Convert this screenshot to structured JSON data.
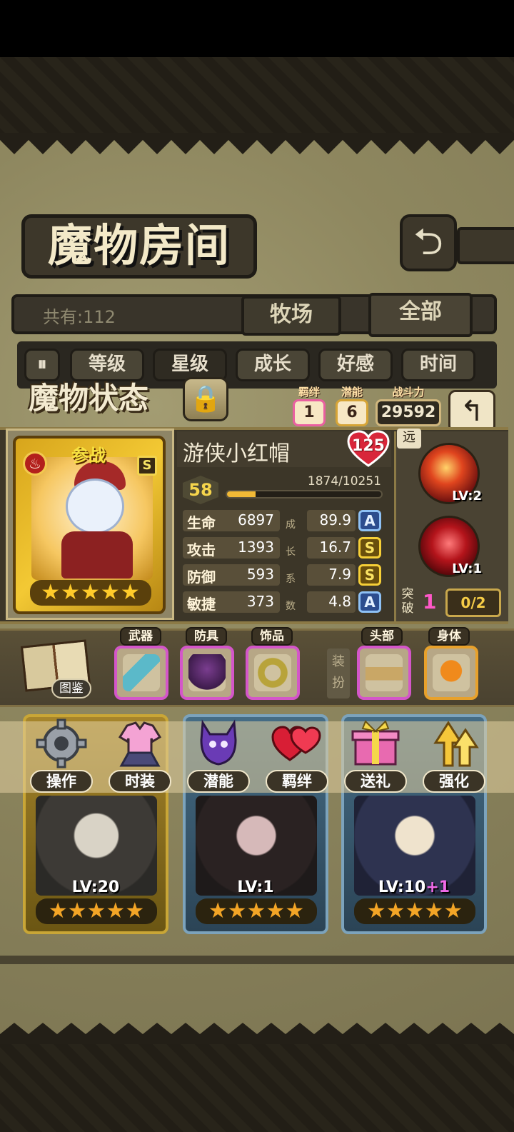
{
  "room": {
    "title": "魔物房间",
    "back_icon": "return-arrow-icon",
    "total_label": "共有:112",
    "tabs": [
      {
        "label": "牧场",
        "active": false
      },
      {
        "label": "全部",
        "active": true
      }
    ],
    "sort_buttons": [
      {
        "label": "等级",
        "active": false
      },
      {
        "label": "星级",
        "active": true
      },
      {
        "label": "成长",
        "active": false
      },
      {
        "label": "好感",
        "active": false
      },
      {
        "label": "时间",
        "active": false
      }
    ]
  },
  "status": {
    "title": "魔物状态",
    "bond_label": "羁绊",
    "bond_value": "1",
    "potential_label": "潜能",
    "potential_value": "6",
    "power_label": "战斗力",
    "power_value": "29592"
  },
  "hero": {
    "name": "游侠小红帽",
    "affection": "125",
    "standby_label": "参战",
    "rank": "S",
    "level": "58",
    "exp_text": "1874/10251",
    "exp_fraction": 0.183,
    "stars": "★★★★★",
    "stats": [
      {
        "name": "生命",
        "value": "6897",
        "growth": "89.9",
        "grade": "A"
      },
      {
        "name": "攻击",
        "value": "1393",
        "growth": "16.7",
        "grade": "S"
      },
      {
        "name": "防御",
        "value": "593",
        "growth": "7.9",
        "grade": "S"
      },
      {
        "name": "敏捷",
        "value": "373",
        "growth": "4.8",
        "grade": "A"
      }
    ],
    "growth_caption": [
      "成",
      "长",
      "系",
      "数"
    ]
  },
  "skills": {
    "range_tag": "远",
    "items": [
      {
        "level": "LV:2",
        "icon": "fire-arrow-skill-icon"
      },
      {
        "level": "LV:1",
        "icon": "blood-orb-skill-icon"
      }
    ],
    "break_label": "突破",
    "break_value": "1",
    "break_progress": "0/2"
  },
  "equipment": {
    "album_label": "图鉴",
    "slots": [
      {
        "label": "武器",
        "icon": "crossbow-icon"
      },
      {
        "label": "防具",
        "icon": "hood-cloak-icon"
      },
      {
        "label": "饰品",
        "icon": "ring-icon"
      }
    ],
    "outfit_tag": "装扮",
    "outfit_slots": [
      {
        "label": "头部",
        "icon": "crown-icon"
      },
      {
        "label": "身体",
        "icon": "pumpkin-icon"
      }
    ]
  },
  "actions": [
    {
      "label": "操作",
      "icon": "gear-icon"
    },
    {
      "label": "时装",
      "icon": "dress-icon"
    },
    {
      "label": "潜能",
      "icon": "demon-icon"
    },
    {
      "label": "羁绊",
      "icon": "hearts-icon"
    },
    {
      "label": "送礼",
      "icon": "gift-icon"
    },
    {
      "label": "强化",
      "icon": "up-arrows-icon"
    }
  ],
  "monster_cards": [
    {
      "level": "LV:20",
      "plus": "",
      "stars": "★★★★★"
    },
    {
      "level": "LV:1",
      "plus": "",
      "stars": "★★★★★"
    },
    {
      "level": "LV:10",
      "plus": "+1",
      "stars": "★★★★★"
    }
  ],
  "colors": {
    "panel_dark": "#3c3628",
    "gold": "#f3c934",
    "pink": "#ea5fa0",
    "grade_a": "#2c4d8e",
    "grade_s": "#6a4f0c"
  }
}
